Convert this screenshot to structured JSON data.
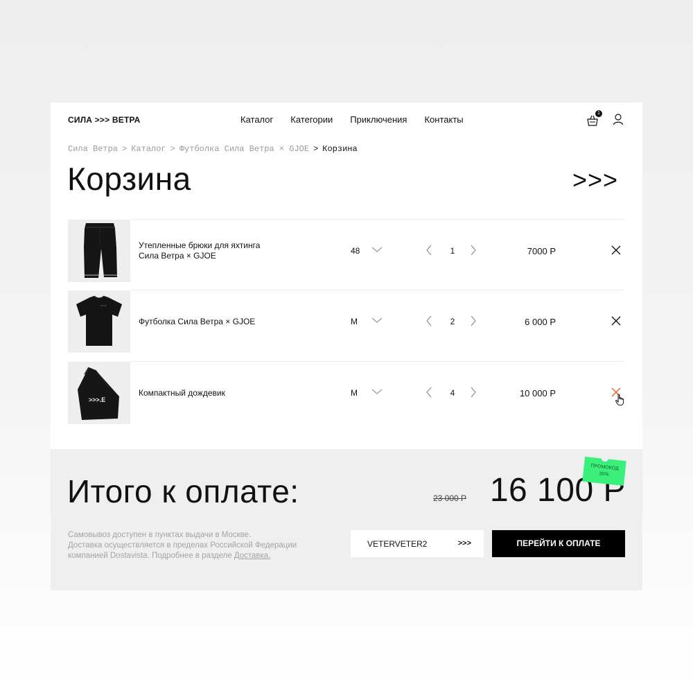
{
  "header": {
    "logo": "СИЛА >>> ВЕТРА",
    "nav": [
      "Каталог",
      "Категории",
      "Приключения",
      "Контакты"
    ],
    "cart_count": "1"
  },
  "breadcrumb": {
    "items": [
      "Сила Ветра",
      "Каталог",
      "Футболка Сила Ветра × GJOE"
    ],
    "separator": ">",
    "current": "Корзина"
  },
  "page": {
    "title": "Корзина",
    "title_arrows": ">>>"
  },
  "cart": {
    "items": [
      {
        "name_line1": "Утепленные брюки для яхтинга",
        "name_line2": "Сила Ветра × GJOE",
        "size": "48",
        "qty": "1",
        "price": "7000 Р",
        "image": "pants-image"
      },
      {
        "name_line1": "Футболка Сила Ветра × GJOE",
        "name_line2": "",
        "size": "M",
        "qty": "2",
        "price": "6 000 Р",
        "image": "tshirt-image"
      },
      {
        "name_line1": "Компактный дождевик",
        "name_line2": "",
        "size": "M",
        "qty": "4",
        "price": "10 000 Р",
        "image": "raincoat-bag-image",
        "bag_print": ">>>.E"
      }
    ]
  },
  "summary": {
    "total_label": "Итого к оплате:",
    "old_price": "23 000 Р",
    "new_price": "16 100 Р",
    "promo_sticker_line1": "ПРОМОКОД",
    "promo_sticker_line2": "30%",
    "delivery_line1": "Самовывоз доступен в пунктах выдачи в Москве.",
    "delivery_line2": "Доставка осуществляется в пределах Российской Федерации",
    "delivery_line3": "компанией Dostavista. Подробнее в разделе ",
    "delivery_link": "Доставка.",
    "promo_code": "VETERVETER2",
    "promo_apply": ">>>",
    "checkout_label": "ПЕРЕЙТИ К ОПЛАТЕ"
  },
  "colors": {
    "accent_promo": "#3af07b",
    "remove_active": "#e85c2b",
    "muted_text": "#a3a3a3"
  }
}
